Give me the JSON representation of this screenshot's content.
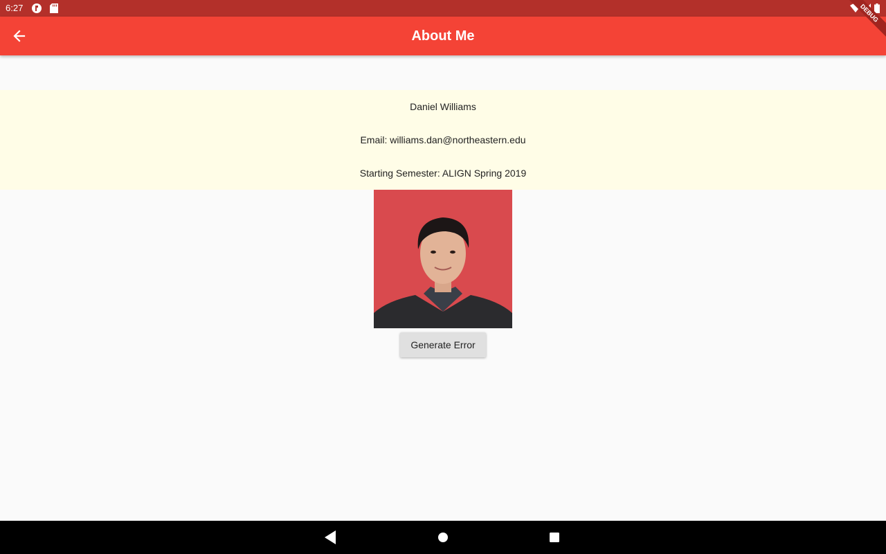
{
  "status_bar": {
    "time": "6:27",
    "left_icons": [
      "flutter-icon",
      "sd-card-icon"
    ],
    "right_icons": [
      "wifi-icon",
      "signal-icon",
      "battery-icon"
    ],
    "color": "#b3302a"
  },
  "app_bar": {
    "title": "About Me",
    "back_icon": "arrow-back-icon",
    "color": "#f44336",
    "debug_banner": "DEBUG"
  },
  "profile": {
    "name": "Daniel Williams",
    "email": "Email: williams.dan@northeastern.edu",
    "semester": "Starting Semester: ALIGN Spring 2019",
    "panel_color": "#fffde7",
    "photo_background": "#d94a4e"
  },
  "actions": {
    "generate_error_label": "Generate Error"
  },
  "nav_bar": {
    "icons": [
      "back-triangle-icon",
      "home-circle-icon",
      "recents-square-icon"
    ]
  }
}
